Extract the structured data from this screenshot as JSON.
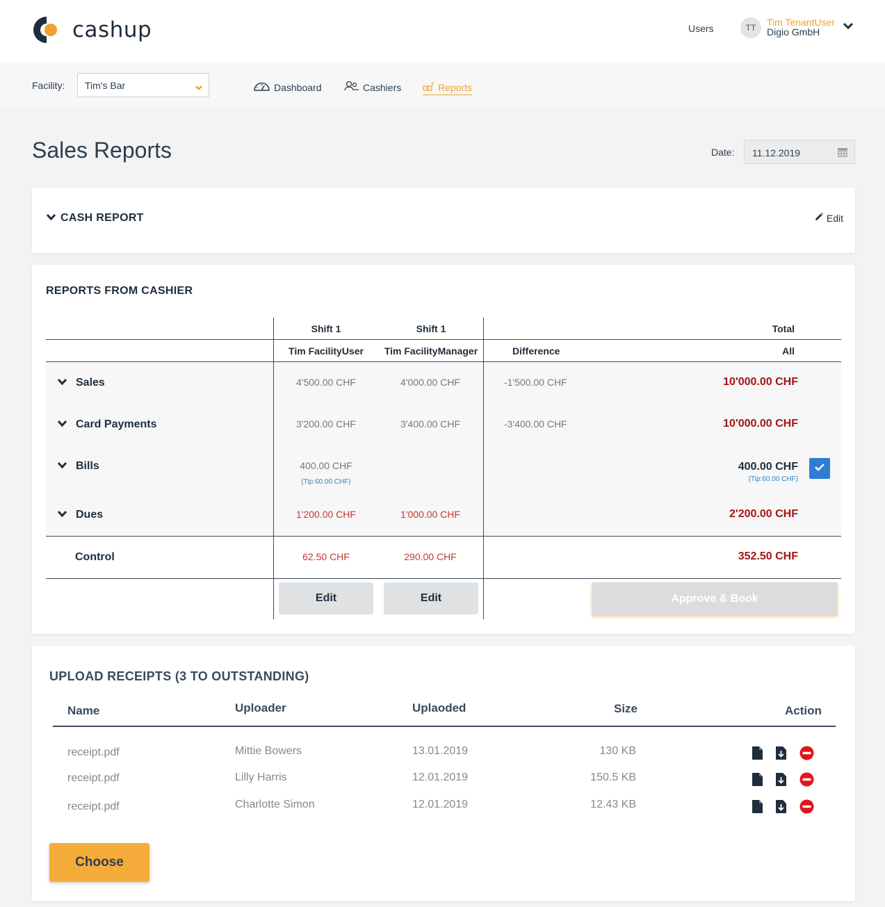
{
  "header": {
    "logo_text": "cashup",
    "users_link": "Users",
    "avatar_initials": "TT",
    "user_name": "Tim TenantUser",
    "user_org": "Digio GmbH"
  },
  "subnav": {
    "facility_label": "Facility:",
    "facility_value": "Tim's Bar",
    "tabs": [
      {
        "label": "Dashboard",
        "icon": "dashboard-gauge-icon"
      },
      {
        "label": "Cashiers",
        "icon": "cashiers-people-icon"
      },
      {
        "label": "Reports",
        "icon": "reports-money-icon",
        "active": true
      }
    ]
  },
  "page": {
    "title": "Sales Reports",
    "date_label": "Date:",
    "date_value": "11.12.2019"
  },
  "cash_report": {
    "title": "CASH REPORT",
    "edit_label": "Edit"
  },
  "reports": {
    "title": "REPORTS FROM CASHIER",
    "columns": {
      "shift_a": "Shift 1",
      "shift_b": "Shift 1",
      "total": "Total",
      "cashier_a": "Tim FacilityUser",
      "cashier_b": "Tim FacilityManager",
      "difference": "Difference",
      "all": "All"
    },
    "rows": [
      {
        "label": "Sales",
        "a": "4'500.00 CHF",
        "b": "4'000.00 CHF",
        "diff": "-1'500.00 CHF",
        "total": "10'000.00 CHF"
      },
      {
        "label": "Card Payments",
        "a": "3'200.00 CHF",
        "b": "3'400.00 CHF",
        "diff": "-3'400.00 CHF",
        "total": "10'000.00 CHF"
      },
      {
        "label": "Bills",
        "a": "400.00 CHF",
        "a_tip": "(Tip:60.00 CHF)",
        "b": "",
        "diff": "",
        "total": "400.00 CHF",
        "total_tip": "(Tip:60.00 CHF)",
        "checked": true
      },
      {
        "label": "Dues",
        "a": "1'200.00 CHF",
        "b": "1'000.00 CHF",
        "diff": "",
        "total": "2'200.00 CHF"
      }
    ],
    "control": {
      "label": "Control",
      "a": "62.50 CHF",
      "b": "290.00 CHF",
      "total": "352.50 CHF"
    },
    "edit_a": "Edit",
    "edit_b": "Edit",
    "approve_label": "Approve & Book"
  },
  "upload": {
    "title": "UPLOAD RECEIPTS (3 TO OUTSTANDING)",
    "headers": {
      "name": "Name",
      "uploader": "Uploader",
      "uploaded": "Uplaoded",
      "size": "Size",
      "action": "Action"
    },
    "files": [
      {
        "name": "receipt.pdf",
        "uploader": "Mittie Bowers",
        "uploaded": "13.01.2019",
        "size": "130 KB"
      },
      {
        "name": "receipt.pdf",
        "uploader": "Lilly Harris",
        "uploaded": "12.01.2019",
        "size": "150.5 KB"
      },
      {
        "name": "receipt.pdf",
        "uploader": "Charlotte Simon",
        "uploaded": "12.01.2019",
        "size": "12.43 KB"
      }
    ],
    "choose_label": "Choose"
  },
  "colors": {
    "accent": "#f0a22e",
    "dark": "#1f2d3d",
    "red": "#a31515",
    "blue": "#2e7cd6"
  }
}
